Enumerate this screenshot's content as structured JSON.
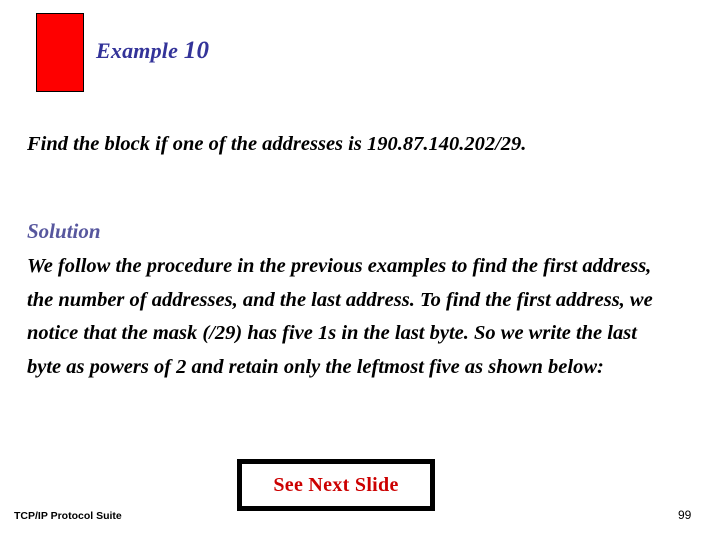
{
  "slide": {
    "background_color": "#ffffff",
    "page_number": "99"
  },
  "header": {
    "marker": {
      "fill_color": "#fe0000",
      "border_color": "#000000"
    },
    "title_prefix": "Example ",
    "title_number": "10",
    "title_color": "#333399"
  },
  "question": {
    "text": "Find the block if one of the addresses is 190.87.140.202/29.",
    "line1": "Find the block if one of the addresses is",
    "address": "190.87.140.202/29."
  },
  "solution": {
    "heading": "Solution",
    "heading_color": "#57579e",
    "body": "We follow the procedure in the previous examples to find the first address, the number of addresses, and the last address. To find the first address, we notice that the mask (/29) has five 1s in the last byte. So we write the last byte as powers of 2 and retain only the leftmost five as shown below:",
    "lines": [
      "We follow the procedure in the previous examples to",
      "find the first address, the number of addresses, and",
      "the last address. To find the first address, we notice",
      "that the mask (/29) has five 1s in the last byte. So we",
      "write the last byte as powers of 2 and retain only the",
      "leftmost five as shown below:"
    ]
  },
  "callout": {
    "label": "See Next Slide",
    "text_color": "#cc0000",
    "border_color": "#000000"
  },
  "footer": {
    "title": "TCP/IP Protocol Suite",
    "page_number": "99"
  }
}
